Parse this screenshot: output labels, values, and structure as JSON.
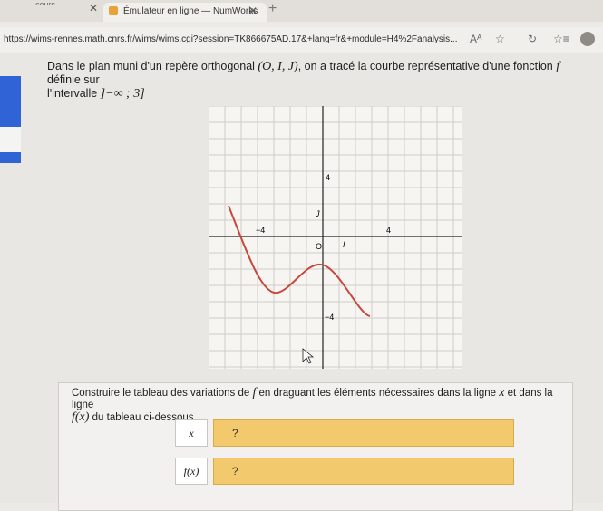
{
  "browser": {
    "inactive_tab_text": "…cours",
    "tab_title": "Émulateur en ligne — NumWorks",
    "url": "https://wims-rennes.math.cnrs.fr/wims/wims.cgi?session=TK866675AD.17&+lang=fr&+module=H4%2Fanalysis..."
  },
  "exercise": {
    "intro_part1": "Dans le plan muni d'un repère orthogonal ",
    "frame": "(O, I, J)",
    "intro_part2": ", on a tracé la courbe représentative d'une fonction ",
    "function_name": "f",
    "intro_part3": " définie sur",
    "interval_label": "l'intervalle ",
    "interval": "]−∞ ; 3]",
    "task_part1": "Construire le tableau des variations de ",
    "task_part2": " en draguant les éléments nécessaires dans la ligne ",
    "var_x": "x",
    "task_part3": " et dans la ligne",
    "task_fx": "f(x)",
    "task_part4": " du tableau ci-dessous."
  },
  "graph": {
    "label_o": "O",
    "label_i": "I",
    "label_j": "J",
    "tick_y_top": "4",
    "tick_x_left": "−4",
    "tick_x_right": "4",
    "tick_y_bottom": "−4",
    "curve_color": "#c8463c"
  },
  "table": {
    "row_x_label": "x",
    "row_fx_label": "f(x)",
    "row_x_value": "?",
    "row_fx_value": "?",
    "field_color": "#f3c96e"
  }
}
